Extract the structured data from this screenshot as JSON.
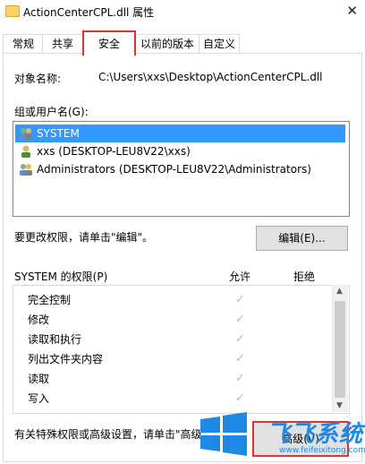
{
  "window": {
    "title": "ActionCenterCPL.dll 属性",
    "close_glyph": "✕"
  },
  "tabs": [
    {
      "label": "常规",
      "active": false
    },
    {
      "label": "共享",
      "active": false
    },
    {
      "label": "安全",
      "active": true
    },
    {
      "label": "以前的版本",
      "active": false
    },
    {
      "label": "自定义",
      "active": false
    }
  ],
  "object": {
    "label": "对象名称:",
    "value": "C:\\Users\\xxs\\Desktop\\ActionCenterCPL.dll"
  },
  "groups": {
    "label": "组或用户名(G):",
    "items": [
      {
        "name": "SYSTEM",
        "selected": true,
        "icon": "user-group-icon"
      },
      {
        "name": "xxs (DESKTOP-LEU8V22\\xxs)",
        "selected": false,
        "icon": "user-icon"
      },
      {
        "name": "Administrators (DESKTOP-LEU8V22\\Administrators)",
        "selected": false,
        "icon": "user-group-icon"
      }
    ]
  },
  "edit": {
    "hint": "要更改权限，请单击\"编辑\"。",
    "button": "编辑(E)..."
  },
  "permissions": {
    "header": "SYSTEM 的权限(P)",
    "allow": "允许",
    "deny": "拒绝",
    "rows": [
      {
        "name": "完全控制",
        "allow": true,
        "deny": false
      },
      {
        "name": "修改",
        "allow": true,
        "deny": false
      },
      {
        "name": "读取和执行",
        "allow": true,
        "deny": false
      },
      {
        "name": "列出文件夹内容",
        "allow": true,
        "deny": false
      },
      {
        "name": "读取",
        "allow": true,
        "deny": false
      },
      {
        "name": "写入",
        "allow": true,
        "deny": false
      }
    ],
    "check_glyph": "✓"
  },
  "advanced": {
    "hint": "有关特殊权限或高级设置，请单击\"高级\"。",
    "button": "高级(V)"
  },
  "watermark": {
    "brand": "飞飞系统",
    "url": "www.feifeixitong.com"
  },
  "colors": {
    "selection": "#3399ff",
    "highlight_border": "#e03434",
    "watermark_blue": "#1e88e5"
  }
}
